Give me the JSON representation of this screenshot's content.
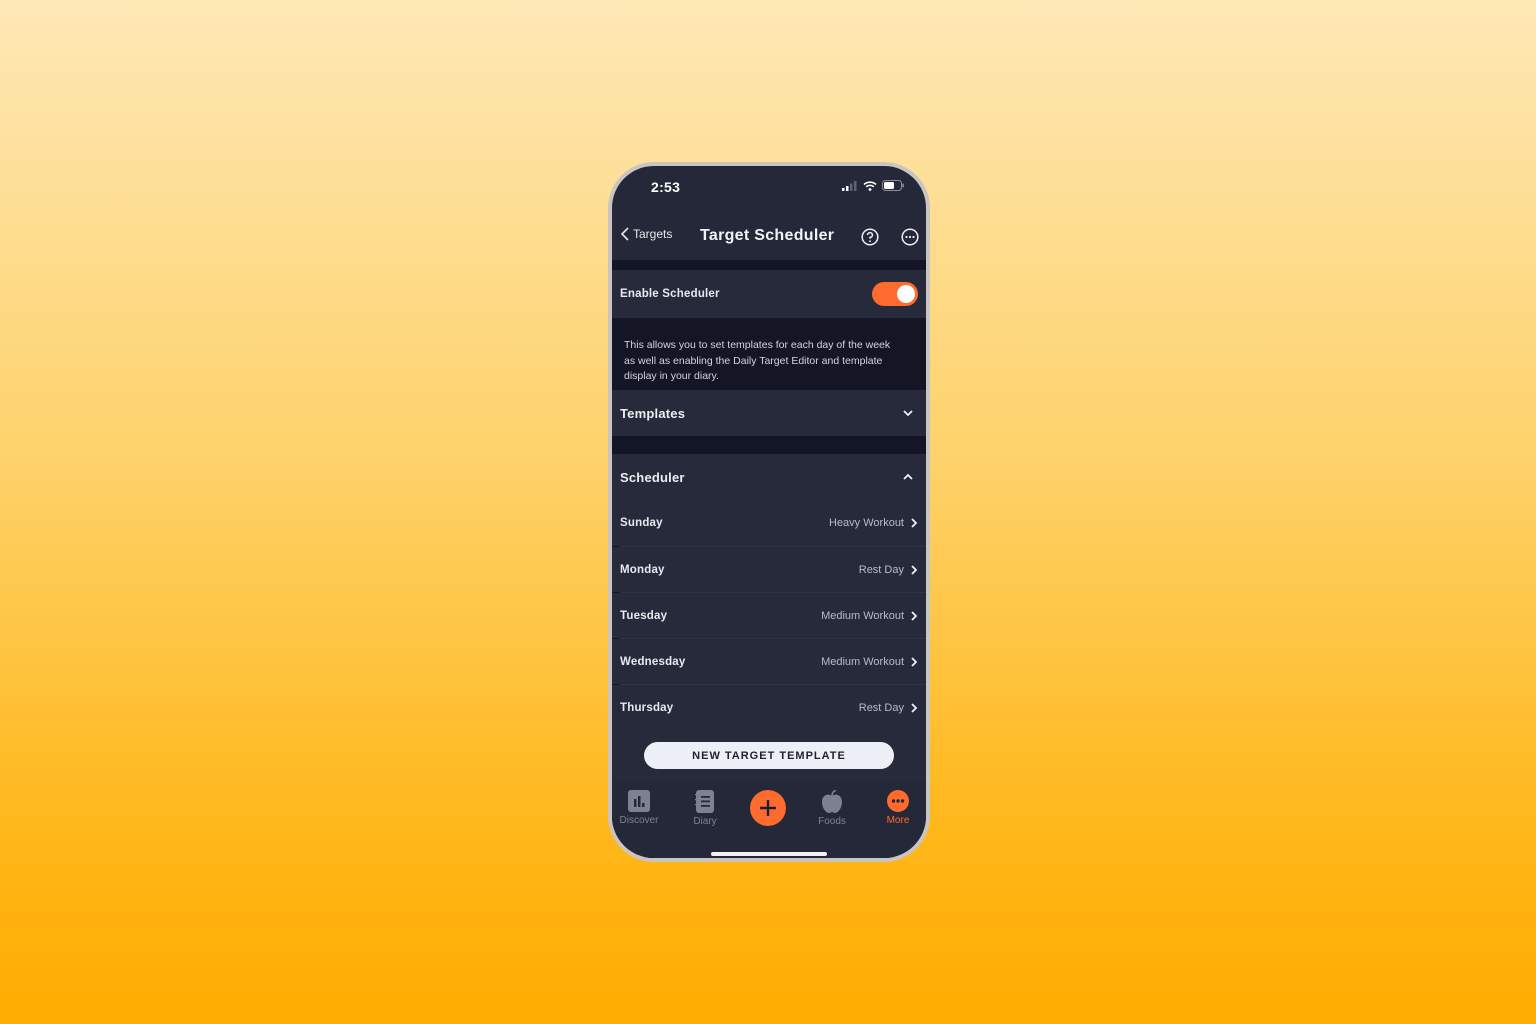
{
  "colors": {
    "accent": "#ff6b2c",
    "screen_bg": "#252838",
    "row_bg": "#262a3b",
    "section_gap_bg": "#141626"
  },
  "status_bar": {
    "time": "2:53",
    "icons": [
      "cellular-signal-icon",
      "wifi-icon",
      "battery-icon"
    ]
  },
  "header": {
    "back_label": "Targets",
    "title": "Target Scheduler",
    "help_icon": "question-circle-icon",
    "more_icon": "ellipsis-circle-icon"
  },
  "enable_scheduler": {
    "label": "Enable Scheduler",
    "enabled": true,
    "description": "This allows you to set templates for each day of the week as well as enabling the Daily Target Editor and template display in your diary."
  },
  "templates_section": {
    "label": "Templates",
    "expanded": false
  },
  "scheduler_section": {
    "label": "Scheduler",
    "expanded": true,
    "days": [
      {
        "day": "Sunday",
        "template": "Heavy Workout"
      },
      {
        "day": "Monday",
        "template": "Rest Day"
      },
      {
        "day": "Tuesday",
        "template": "Medium Workout"
      },
      {
        "day": "Wednesday",
        "template": "Medium Workout"
      },
      {
        "day": "Thursday",
        "template": "Rest Day"
      }
    ]
  },
  "new_template_button": "NEW TARGET TEMPLATE",
  "tab_bar": {
    "tabs": [
      {
        "label": "Discover",
        "icon": "bar-chart-icon",
        "active": false
      },
      {
        "label": "Diary",
        "icon": "notebook-icon",
        "active": false
      },
      {
        "label": "",
        "icon": "plus-icon",
        "active": false
      },
      {
        "label": "Foods",
        "icon": "apple-icon",
        "active": false
      },
      {
        "label": "More",
        "icon": "more-dots-icon",
        "active": true
      }
    ]
  }
}
